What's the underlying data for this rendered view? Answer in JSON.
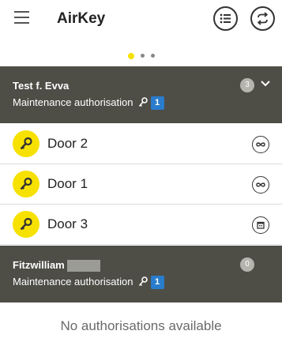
{
  "app_bar": {
    "title": "AirKey",
    "menu_icon": "hamburger-menu-icon",
    "list_icon": "list-view-icon",
    "sync_icon": "sync-icon"
  },
  "pager": {
    "pages": 3,
    "active_index": 0
  },
  "groups": [
    {
      "name": "Test f. Evva",
      "subtitle": "Maintenance authorisation",
      "auth_badge": "1",
      "count": "3",
      "expanded": true,
      "doors": [
        {
          "label": "Door 2",
          "status_icon": "infinity-icon"
        },
        {
          "label": "Door 1",
          "status_icon": "infinity-icon"
        },
        {
          "label": "Door 3",
          "status_icon": "calendar-icon"
        }
      ]
    },
    {
      "name": "Fitzwilliam",
      "subtitle": "Maintenance authorisation",
      "auth_badge": "1",
      "count": "0",
      "expanded": false,
      "empty_message": "No authorisations available"
    }
  ],
  "colors": {
    "accent": "#f7e100",
    "header_bg": "#4e4e47",
    "badge_blue": "#2a7ccc"
  }
}
